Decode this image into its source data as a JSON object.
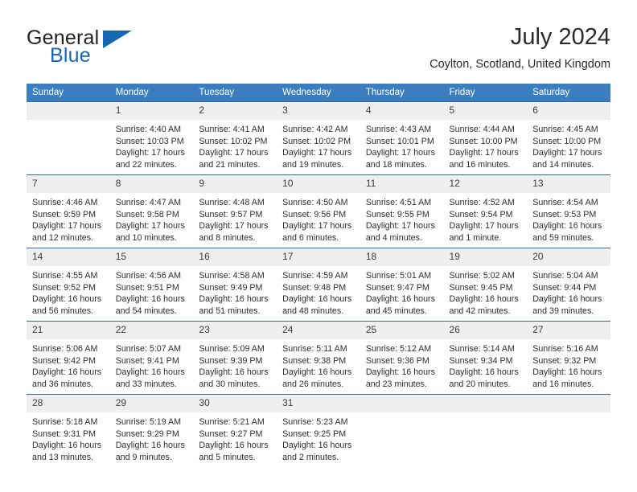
{
  "brand": {
    "name_part1": "General",
    "name_part2": "Blue",
    "triangle_color": "#1567b2",
    "logo_icon": "blue-triangle-icon"
  },
  "header": {
    "title": "July 2024",
    "subtitle": "Coylton, Scotland, United Kingdom"
  },
  "theme": {
    "header_row_bg": "#3a7ebf",
    "row_divider": "#2e6da4",
    "daynum_bg": "#efefef",
    "text": "#2e2e2e"
  },
  "weekdays": [
    "Sunday",
    "Monday",
    "Tuesday",
    "Wednesday",
    "Thursday",
    "Friday",
    "Saturday"
  ],
  "labels": {
    "sunrise_prefix": "Sunrise:",
    "sunset_prefix": "Sunset:",
    "daylight_prefix": "Daylight:"
  },
  "weeks": [
    {
      "days": [
        {
          "num": "",
          "sunrise": "",
          "sunset": "",
          "daylight1": "",
          "daylight2": "",
          "empty": true
        },
        {
          "num": "1",
          "sunrise": "Sunrise: 4:40 AM",
          "sunset": "Sunset: 10:03 PM",
          "daylight1": "Daylight: 17 hours",
          "daylight2": "and 22 minutes.",
          "empty": false
        },
        {
          "num": "2",
          "sunrise": "Sunrise: 4:41 AM",
          "sunset": "Sunset: 10:02 PM",
          "daylight1": "Daylight: 17 hours",
          "daylight2": "and 21 minutes.",
          "empty": false
        },
        {
          "num": "3",
          "sunrise": "Sunrise: 4:42 AM",
          "sunset": "Sunset: 10:02 PM",
          "daylight1": "Daylight: 17 hours",
          "daylight2": "and 19 minutes.",
          "empty": false
        },
        {
          "num": "4",
          "sunrise": "Sunrise: 4:43 AM",
          "sunset": "Sunset: 10:01 PM",
          "daylight1": "Daylight: 17 hours",
          "daylight2": "and 18 minutes.",
          "empty": false
        },
        {
          "num": "5",
          "sunrise": "Sunrise: 4:44 AM",
          "sunset": "Sunset: 10:00 PM",
          "daylight1": "Daylight: 17 hours",
          "daylight2": "and 16 minutes.",
          "empty": false
        },
        {
          "num": "6",
          "sunrise": "Sunrise: 4:45 AM",
          "sunset": "Sunset: 10:00 PM",
          "daylight1": "Daylight: 17 hours",
          "daylight2": "and 14 minutes.",
          "empty": false
        }
      ]
    },
    {
      "days": [
        {
          "num": "7",
          "sunrise": "Sunrise: 4:46 AM",
          "sunset": "Sunset: 9:59 PM",
          "daylight1": "Daylight: 17 hours",
          "daylight2": "and 12 minutes.",
          "empty": false
        },
        {
          "num": "8",
          "sunrise": "Sunrise: 4:47 AM",
          "sunset": "Sunset: 9:58 PM",
          "daylight1": "Daylight: 17 hours",
          "daylight2": "and 10 minutes.",
          "empty": false
        },
        {
          "num": "9",
          "sunrise": "Sunrise: 4:48 AM",
          "sunset": "Sunset: 9:57 PM",
          "daylight1": "Daylight: 17 hours",
          "daylight2": "and 8 minutes.",
          "empty": false
        },
        {
          "num": "10",
          "sunrise": "Sunrise: 4:50 AM",
          "sunset": "Sunset: 9:56 PM",
          "daylight1": "Daylight: 17 hours",
          "daylight2": "and 6 minutes.",
          "empty": false
        },
        {
          "num": "11",
          "sunrise": "Sunrise: 4:51 AM",
          "sunset": "Sunset: 9:55 PM",
          "daylight1": "Daylight: 17 hours",
          "daylight2": "and 4 minutes.",
          "empty": false
        },
        {
          "num": "12",
          "sunrise": "Sunrise: 4:52 AM",
          "sunset": "Sunset: 9:54 PM",
          "daylight1": "Daylight: 17 hours",
          "daylight2": "and 1 minute.",
          "empty": false
        },
        {
          "num": "13",
          "sunrise": "Sunrise: 4:54 AM",
          "sunset": "Sunset: 9:53 PM",
          "daylight1": "Daylight: 16 hours",
          "daylight2": "and 59 minutes.",
          "empty": false
        }
      ]
    },
    {
      "days": [
        {
          "num": "14",
          "sunrise": "Sunrise: 4:55 AM",
          "sunset": "Sunset: 9:52 PM",
          "daylight1": "Daylight: 16 hours",
          "daylight2": "and 56 minutes.",
          "empty": false
        },
        {
          "num": "15",
          "sunrise": "Sunrise: 4:56 AM",
          "sunset": "Sunset: 9:51 PM",
          "daylight1": "Daylight: 16 hours",
          "daylight2": "and 54 minutes.",
          "empty": false
        },
        {
          "num": "16",
          "sunrise": "Sunrise: 4:58 AM",
          "sunset": "Sunset: 9:49 PM",
          "daylight1": "Daylight: 16 hours",
          "daylight2": "and 51 minutes.",
          "empty": false
        },
        {
          "num": "17",
          "sunrise": "Sunrise: 4:59 AM",
          "sunset": "Sunset: 9:48 PM",
          "daylight1": "Daylight: 16 hours",
          "daylight2": "and 48 minutes.",
          "empty": false
        },
        {
          "num": "18",
          "sunrise": "Sunrise: 5:01 AM",
          "sunset": "Sunset: 9:47 PM",
          "daylight1": "Daylight: 16 hours",
          "daylight2": "and 45 minutes.",
          "empty": false
        },
        {
          "num": "19",
          "sunrise": "Sunrise: 5:02 AM",
          "sunset": "Sunset: 9:45 PM",
          "daylight1": "Daylight: 16 hours",
          "daylight2": "and 42 minutes.",
          "empty": false
        },
        {
          "num": "20",
          "sunrise": "Sunrise: 5:04 AM",
          "sunset": "Sunset: 9:44 PM",
          "daylight1": "Daylight: 16 hours",
          "daylight2": "and 39 minutes.",
          "empty": false
        }
      ]
    },
    {
      "days": [
        {
          "num": "21",
          "sunrise": "Sunrise: 5:06 AM",
          "sunset": "Sunset: 9:42 PM",
          "daylight1": "Daylight: 16 hours",
          "daylight2": "and 36 minutes.",
          "empty": false
        },
        {
          "num": "22",
          "sunrise": "Sunrise: 5:07 AM",
          "sunset": "Sunset: 9:41 PM",
          "daylight1": "Daylight: 16 hours",
          "daylight2": "and 33 minutes.",
          "empty": false
        },
        {
          "num": "23",
          "sunrise": "Sunrise: 5:09 AM",
          "sunset": "Sunset: 9:39 PM",
          "daylight1": "Daylight: 16 hours",
          "daylight2": "and 30 minutes.",
          "empty": false
        },
        {
          "num": "24",
          "sunrise": "Sunrise: 5:11 AM",
          "sunset": "Sunset: 9:38 PM",
          "daylight1": "Daylight: 16 hours",
          "daylight2": "and 26 minutes.",
          "empty": false
        },
        {
          "num": "25",
          "sunrise": "Sunrise: 5:12 AM",
          "sunset": "Sunset: 9:36 PM",
          "daylight1": "Daylight: 16 hours",
          "daylight2": "and 23 minutes.",
          "empty": false
        },
        {
          "num": "26",
          "sunrise": "Sunrise: 5:14 AM",
          "sunset": "Sunset: 9:34 PM",
          "daylight1": "Daylight: 16 hours",
          "daylight2": "and 20 minutes.",
          "empty": false
        },
        {
          "num": "27",
          "sunrise": "Sunrise: 5:16 AM",
          "sunset": "Sunset: 9:32 PM",
          "daylight1": "Daylight: 16 hours",
          "daylight2": "and 16 minutes.",
          "empty": false
        }
      ]
    },
    {
      "days": [
        {
          "num": "28",
          "sunrise": "Sunrise: 5:18 AM",
          "sunset": "Sunset: 9:31 PM",
          "daylight1": "Daylight: 16 hours",
          "daylight2": "and 13 minutes.",
          "empty": false
        },
        {
          "num": "29",
          "sunrise": "Sunrise: 5:19 AM",
          "sunset": "Sunset: 9:29 PM",
          "daylight1": "Daylight: 16 hours",
          "daylight2": "and 9 minutes.",
          "empty": false
        },
        {
          "num": "30",
          "sunrise": "Sunrise: 5:21 AM",
          "sunset": "Sunset: 9:27 PM",
          "daylight1": "Daylight: 16 hours",
          "daylight2": "and 5 minutes.",
          "empty": false
        },
        {
          "num": "31",
          "sunrise": "Sunrise: 5:23 AM",
          "sunset": "Sunset: 9:25 PM",
          "daylight1": "Daylight: 16 hours",
          "daylight2": "and 2 minutes.",
          "empty": false
        },
        {
          "num": "",
          "sunrise": "",
          "sunset": "",
          "daylight1": "",
          "daylight2": "",
          "empty": true
        },
        {
          "num": "",
          "sunrise": "",
          "sunset": "",
          "daylight1": "",
          "daylight2": "",
          "empty": true
        },
        {
          "num": "",
          "sunrise": "",
          "sunset": "",
          "daylight1": "",
          "daylight2": "",
          "empty": true
        }
      ]
    }
  ]
}
